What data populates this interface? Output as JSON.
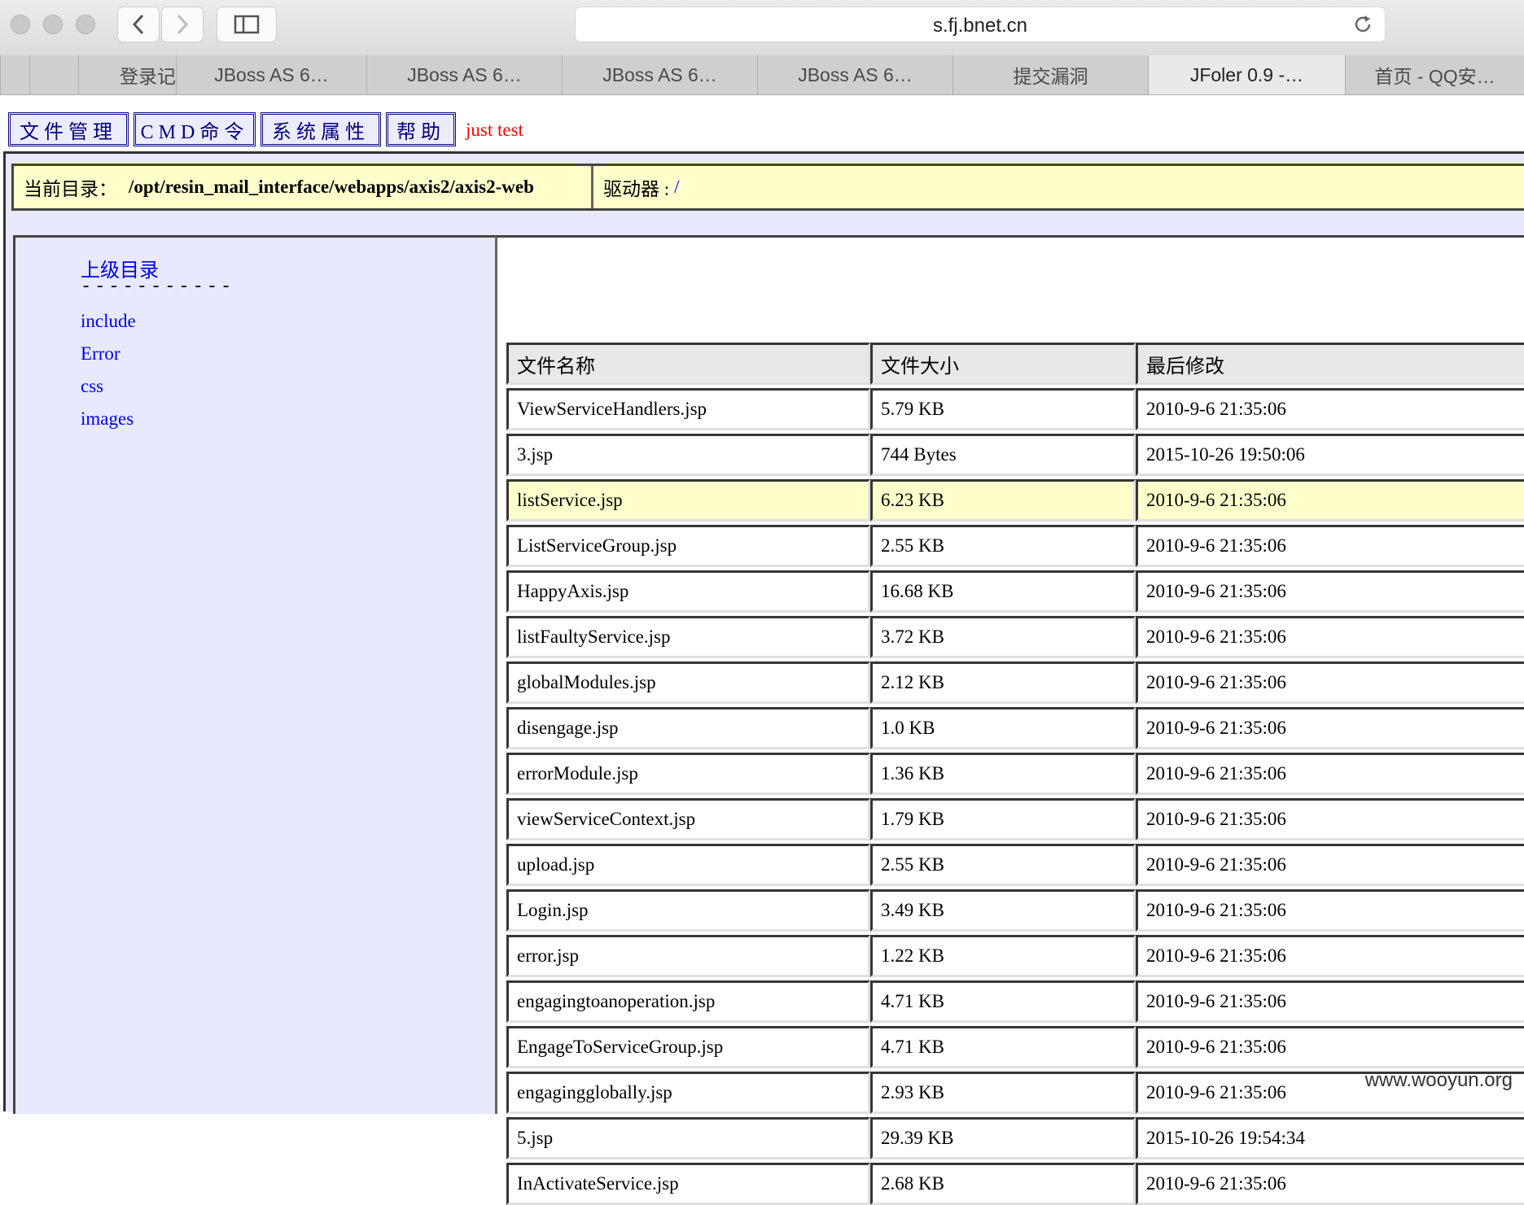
{
  "browser": {
    "url": "s.fj.bnet.cn",
    "tabs": [
      {
        "label": "登录记"
      },
      {
        "label": "JBoss AS 6…"
      },
      {
        "label": "JBoss AS 6…"
      },
      {
        "label": "JBoss AS 6…"
      },
      {
        "label": "JBoss AS 6…"
      },
      {
        "label": "提交漏洞"
      },
      {
        "label": "JFoler 0.9 -…",
        "active": true
      },
      {
        "label": "首页 - QQ安…"
      }
    ]
  },
  "menu": {
    "buttons": [
      "文件管理",
      "CMD命令",
      "系统属性",
      "帮助"
    ],
    "note": "just test"
  },
  "location": {
    "dir_label": "当前目录：",
    "dir_path": "/opt/resin_mail_interface/webapps/axis2/axis2-web",
    "drive_label": "驱动器 :",
    "drive_value": "/"
  },
  "sidebar": {
    "parent_label": "上级目录",
    "separator": "-----------",
    "folders": [
      "include",
      "Error",
      "css",
      "images"
    ]
  },
  "table": {
    "headers": [
      "文件名称",
      "文件大小",
      "最后修改"
    ],
    "rows": [
      {
        "name": "ViewServiceHandlers.jsp",
        "size": "5.79 KB",
        "modified": "2010-9-6 21:35:06"
      },
      {
        "name": "3.jsp",
        "size": "744 Bytes",
        "modified": "2015-10-26 19:50:06"
      },
      {
        "name": "listService.jsp",
        "size": "6.23 KB",
        "modified": "2010-9-6 21:35:06",
        "highlighted": true
      },
      {
        "name": "ListServiceGroup.jsp",
        "size": "2.55 KB",
        "modified": "2010-9-6 21:35:06"
      },
      {
        "name": "HappyAxis.jsp",
        "size": "16.68 KB",
        "modified": "2010-9-6 21:35:06"
      },
      {
        "name": "listFaultyService.jsp",
        "size": "3.72 KB",
        "modified": "2010-9-6 21:35:06"
      },
      {
        "name": "globalModules.jsp",
        "size": "2.12 KB",
        "modified": "2010-9-6 21:35:06"
      },
      {
        "name": "disengage.jsp",
        "size": "1.0 KB",
        "modified": "2010-9-6 21:35:06"
      },
      {
        "name": "errorModule.jsp",
        "size": "1.36 KB",
        "modified": "2010-9-6 21:35:06"
      },
      {
        "name": "viewServiceContext.jsp",
        "size": "1.79 KB",
        "modified": "2010-9-6 21:35:06"
      },
      {
        "name": "upload.jsp",
        "size": "2.55 KB",
        "modified": "2010-9-6 21:35:06"
      },
      {
        "name": "Login.jsp",
        "size": "3.49 KB",
        "modified": "2010-9-6 21:35:06"
      },
      {
        "name": "error.jsp",
        "size": "1.22 KB",
        "modified": "2010-9-6 21:35:06"
      },
      {
        "name": "engagingtoanoperation.jsp",
        "size": "4.71 KB",
        "modified": "2010-9-6 21:35:06"
      },
      {
        "name": "EngageToServiceGroup.jsp",
        "size": "4.71 KB",
        "modified": "2010-9-6 21:35:06"
      },
      {
        "name": "engagingglobally.jsp",
        "size": "2.93 KB",
        "modified": "2010-9-6 21:35:06"
      },
      {
        "name": "5.jsp",
        "size": "29.39 KB",
        "modified": "2015-10-26 19:54:34"
      },
      {
        "name": "InActivateService.jsp",
        "size": "2.68 KB",
        "modified": "2010-9-6 21:35:06"
      }
    ]
  },
  "watermark": "www.wooyun.org"
}
